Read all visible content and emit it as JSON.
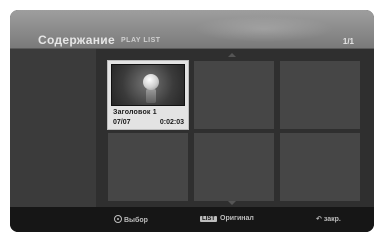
{
  "header": {
    "title": "Содержание",
    "subtitle": "PLAY LIST",
    "page_indicator": "1/1"
  },
  "items": [
    {
      "title": "Заголовок 1",
      "date": "07/07",
      "duration": "0:02:03"
    }
  ],
  "footer": {
    "select_label": "Выбор",
    "list_button": "LIST",
    "list_label": "Оригинал",
    "close_label": "закр."
  }
}
